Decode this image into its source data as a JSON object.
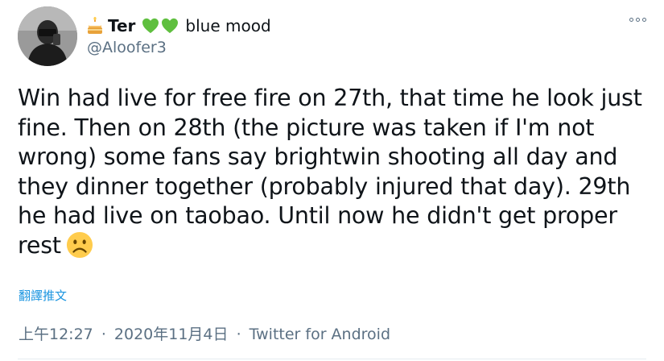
{
  "author": {
    "name_prefix": "Ter",
    "name_suffix": "blue mood",
    "handle": "@Aloofer3",
    "heart_color": "#5fbf3f"
  },
  "tweet": {
    "text": "Win had live for free fire on 27th, that time he look just fine. Then on 28th (the picture was taken if I'm not wrong) some fans say brightwin shooting all day and they dinner together (probably injured that day). 29th he had live on taobao. Until now he didn't get proper rest",
    "translate_label": "翻譯推文",
    "time": "上午12:27",
    "date": "2020年11月4日",
    "source": "Twitter for Android",
    "separator": "·"
  },
  "icons": {
    "cake": "birthday-cake-icon",
    "hearts": "green-heart-icon",
    "sad": "sad-face-icon",
    "more": "more-options-icon"
  }
}
